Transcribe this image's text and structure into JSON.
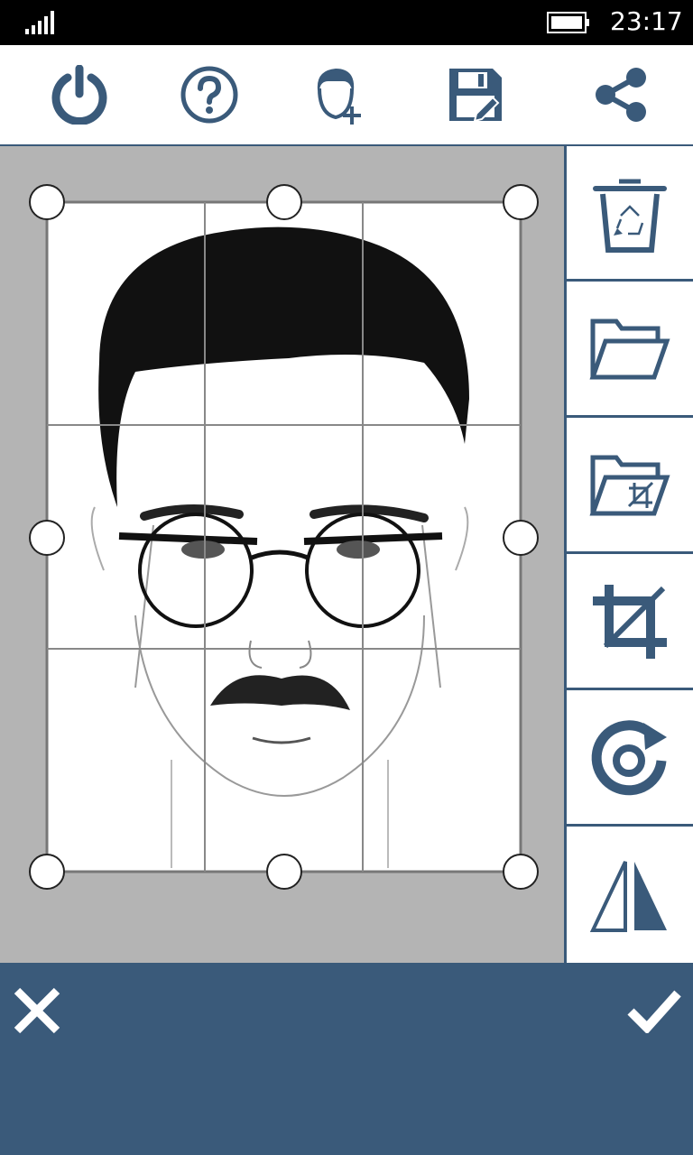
{
  "status_bar": {
    "time": "23:17"
  },
  "colors": {
    "accent": "#3a5a7a",
    "canvas_background": "#b4b4b4",
    "status_bar": "#000000"
  },
  "toolbar": {
    "items": [
      {
        "icon": "power-icon"
      },
      {
        "icon": "help-icon"
      },
      {
        "icon": "add-face-icon"
      },
      {
        "icon": "save-icon"
      },
      {
        "icon": "share-icon"
      }
    ]
  },
  "sidebar": {
    "items": [
      {
        "icon": "trash-icon"
      },
      {
        "icon": "open-folder-icon"
      },
      {
        "icon": "folder-crop-icon"
      },
      {
        "icon": "crop-icon"
      },
      {
        "icon": "rotate-icon"
      },
      {
        "icon": "flip-icon"
      }
    ]
  },
  "bottom_bar": {
    "cancel_icon": "close-icon",
    "confirm_icon": "check-icon"
  }
}
